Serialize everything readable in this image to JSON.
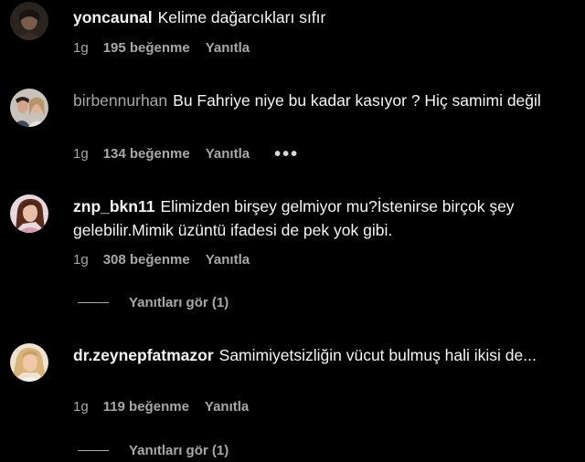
{
  "comments": [
    {
      "username": "yoncaunal",
      "text": "Kelime dağarcıkları sıfır",
      "time": "1g",
      "likes": "195 beğenme",
      "reply_label": "Yanıtla"
    },
    {
      "username": "birbennurhan",
      "text": "Bu Fahriye niye bu kadar kasıyor ? Hiç samimi değil",
      "time": "1g",
      "likes": "134 beğenme",
      "reply_label": "Yanıtla",
      "more_label": "•••"
    },
    {
      "username": "znp_bkn11",
      "text": "Elimizden birşey gelmiyor mu?İstenirse birçok şey gelebilir.Mimik üzüntü ifadesi de pek yok gibi.",
      "time": "1g",
      "likes": "308 beğenme",
      "reply_label": "Yanıtla",
      "view_replies": "Yanıtları gör (1)"
    },
    {
      "username": "dr.zeynepfatmazor",
      "text": "Samimiyetsizliğin vücut bulmuş hali ikisi de...",
      "time": "1g",
      "likes": "119 beğenme",
      "reply_label": "Yanıtla",
      "view_replies": "Yanıtları gör (1)"
    }
  ]
}
